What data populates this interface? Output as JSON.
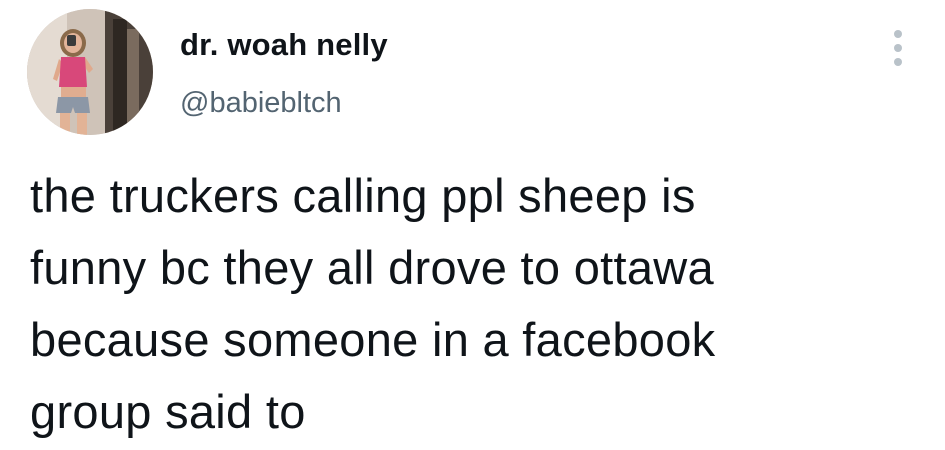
{
  "author": {
    "display_name": "dr. woah nelly",
    "handle": "@babiebltch",
    "avatar_icon": "profile-photo"
  },
  "menu": {
    "icon": "more-vertical-icon"
  },
  "tweet": {
    "lines": [
      "the truckers calling ppl sheep is",
      "funny bc they all drove to ottawa",
      "because someone in a facebook",
      "group said to"
    ]
  },
  "colors": {
    "text": "#0f1419",
    "secondary_text": "#536471",
    "icon_gray": "#b9c2c9",
    "background": "#ffffff"
  }
}
